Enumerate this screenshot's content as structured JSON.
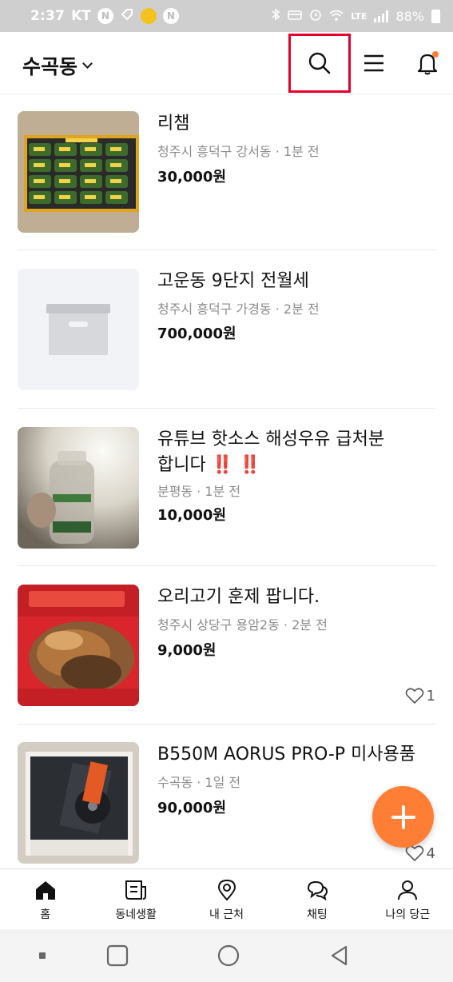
{
  "status_bar": {
    "time": "2:37",
    "carrier": "KT",
    "network": "LTE",
    "battery": "88%"
  },
  "header": {
    "location": "수곡동"
  },
  "listings": [
    {
      "title": "리챔",
      "meta": "청주시 흥덕구 강서동 · 1분 전",
      "price": "30,000원",
      "likes": ""
    },
    {
      "title": "고운동 9단지 전월세",
      "meta": "청주시 흥덕구 가경동 · 2분 전",
      "price": "700,000원",
      "likes": ""
    },
    {
      "title_line1": "유튜브 핫소스 해성우유 급처분",
      "title_line2": "합니다 ‼️ ‼️",
      "meta": "분평동 · 1분 전",
      "price": "10,000원",
      "likes": ""
    },
    {
      "title": "오리고기 훈제 팝니다.",
      "meta": "청주시 상당구 용암2동 · 2분 전",
      "price": "9,000원",
      "likes": "1"
    },
    {
      "title": "B550M AORUS PRO-P 미사용품",
      "meta": "수곡동 · 1일 전",
      "price": "90,000원",
      "likes": "4"
    }
  ],
  "bottom_nav": {
    "home": "홈",
    "community": "동네생활",
    "nearby": "내 근처",
    "chat": "채팅",
    "my": "나의 당근"
  },
  "colors": {
    "accent": "#ff7e36",
    "highlight_box": "#e4002b",
    "notification_dot": "#ff7e36"
  }
}
